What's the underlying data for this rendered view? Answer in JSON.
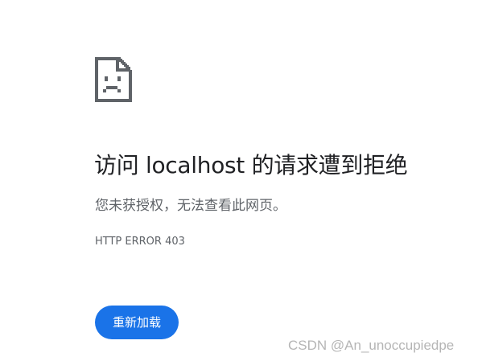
{
  "error_page": {
    "icon": "sad-document-icon",
    "title": "访问 localhost 的请求遭到拒绝",
    "message": "您未获授权，无法查看此网页。",
    "error_code": "HTTP ERROR 403",
    "reload_button_label": "重新加载"
  },
  "watermark": "CSDN @An_unoccupiedpe",
  "colors": {
    "background": "#ffffff",
    "title_text": "#202124",
    "secondary_text": "#5f6368",
    "icon": "#5f6368",
    "button": "#1a73e8",
    "button_text": "#ffffff"
  }
}
